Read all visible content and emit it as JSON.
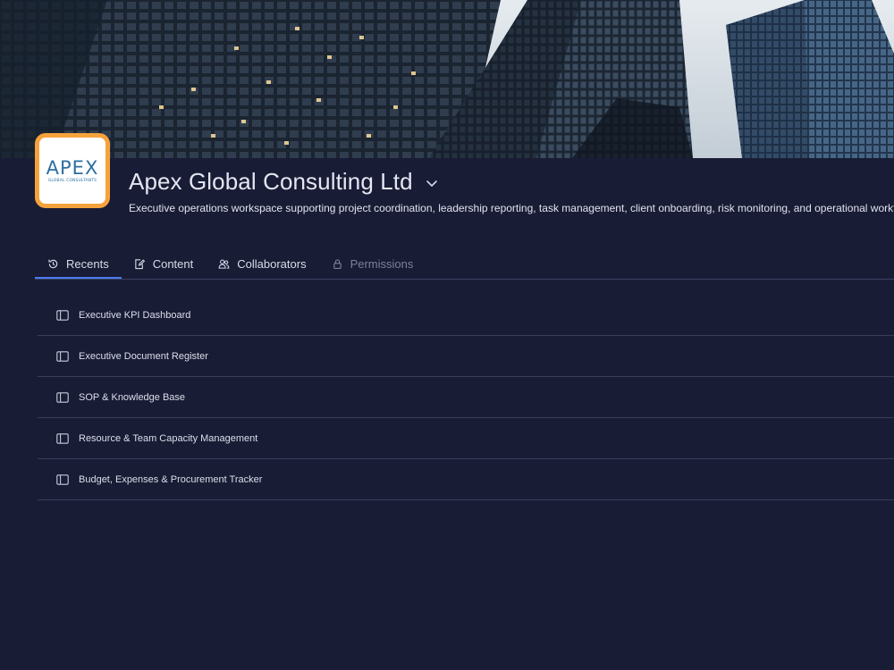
{
  "workspace": {
    "name": "Apex Global Consulting Ltd",
    "description": "Executive operations workspace supporting project coordination, leadership reporting, task management, client onboarding, risk monitoring, and operational workflows.",
    "logo": {
      "word": "APEX",
      "subtitle": "GLOBAL CONSULTANTS"
    }
  },
  "tabs": [
    {
      "label": "Recents",
      "icon": "history-icon",
      "active": true
    },
    {
      "label": "Content",
      "icon": "edit-doc-icon"
    },
    {
      "label": "Collaborators",
      "icon": "people-icon"
    },
    {
      "label": "Permissions",
      "icon": "lock-icon",
      "disabled": true
    }
  ],
  "recents": [
    {
      "label": "Executive KPI Dashboard",
      "icon": "sidebar-page-icon"
    },
    {
      "label": "Executive Document Register",
      "icon": "sidebar-page-icon"
    },
    {
      "label": "SOP & Knowledge Base",
      "icon": "sidebar-page-icon"
    },
    {
      "label": "Resource & Team Capacity Management",
      "icon": "sidebar-page-icon"
    },
    {
      "label": "Budget, Expenses & Procurement Tracker",
      "icon": "sidebar-page-icon"
    }
  ],
  "colors": {
    "background": "#191c35",
    "accent": "#4b7cf0",
    "logo_border": "#f6a23c",
    "logo_text": "#2d6fa1"
  }
}
